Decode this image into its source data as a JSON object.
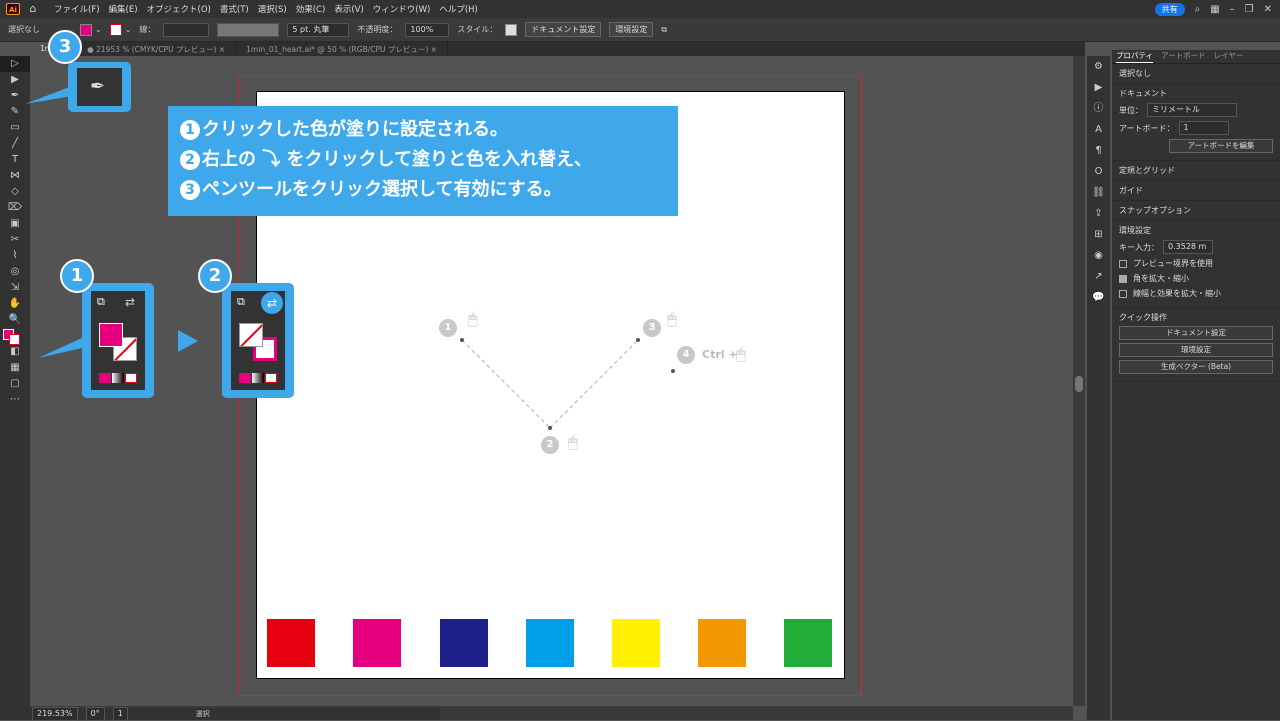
{
  "app": {
    "logo": "Ai",
    "home_icon": "home-icon"
  },
  "menubar": {
    "items": [
      "ファイル(F)",
      "編集(E)",
      "オブジェクト(O)",
      "書式(T)",
      "選択(S)",
      "効果(C)",
      "表示(V)",
      "ウィンドウ(W)",
      "ヘルプ(H)"
    ],
    "share_label": "共有"
  },
  "controlbar": {
    "selection": "選択なし",
    "stroke_label": "線：",
    "stroke_profile": "5 pt. 丸筆",
    "opacity_label": "不透明度：",
    "opacity_value": "100%",
    "style_label": "スタイル：",
    "doc_setup": "ドキュメント設定",
    "preferences": "環境設定"
  },
  "tabs": [
    {
      "label": "1min...",
      "active": true
    },
    {
      "label": "● 21953 % (CMYK/CPU プレビュー) ×",
      "active": false
    },
    {
      "label": "1min_01_heart.ai* @ 50 % (RGB/CPU プレビュー) ×",
      "active": false
    }
  ],
  "tools": [
    "▷",
    "▶",
    "✒",
    "✎",
    "▭",
    "╱",
    "T",
    "⋈",
    "◇",
    "⌦",
    "▣",
    "✂",
    "⌇",
    "◎",
    "⇲",
    "✋",
    "🔍",
    "■",
    "◧",
    "▦",
    "▢",
    "⋯"
  ],
  "callout": {
    "line1": "クリックした色が塗りに設定される。",
    "line2a": "右上の",
    "line2b": "をクリックして塗りと色を入れ替え、",
    "line3": "ペンツールをクリック選択して有効にする。",
    "n1": "1",
    "n2": "2",
    "n3": "3"
  },
  "badges": {
    "b1": "1",
    "b2": "2",
    "b3": "3"
  },
  "steps": {
    "s1": "1",
    "s2": "2",
    "s3": "3",
    "s4": "4",
    "ctrl": "Ctrl +"
  },
  "swatches": [
    "#e60012",
    "#e4007f",
    "#1d2088",
    "#00a0e9",
    "#fff100",
    "#f39800",
    "#22ac38"
  ],
  "status": {
    "zoom": "219.53%",
    "angle": "0°",
    "artboard": "1",
    "mode": "選択"
  },
  "panel": {
    "tabs": [
      "プロパティ",
      "アートボード",
      "レイヤー"
    ],
    "selection": "選択なし",
    "document_heading": "ドキュメント",
    "unit_label": "単位：",
    "unit_value": "ミリメートル",
    "artboard_label": "アートボード：",
    "artboard_value": "1",
    "edit_artboard": "アートボードを編集",
    "rulers_grid": "定規とグリッド",
    "guides": "ガイド",
    "snap": "スナップオプション",
    "prefs_heading": "環境設定",
    "key_input_label": "キー入力：",
    "key_input_value": "0.3528 m",
    "preview_bounds": "プレビュー境界を使用",
    "scale_corners": "角を拡大・縮小",
    "scale_strokes": "線幅と効果を拡大・縮小",
    "quick_actions": "クイック操作",
    "qa_doc": "ドキュメント設定",
    "qa_prefs": "環境設定",
    "qa_vector": "生成ベクター (Beta)"
  }
}
